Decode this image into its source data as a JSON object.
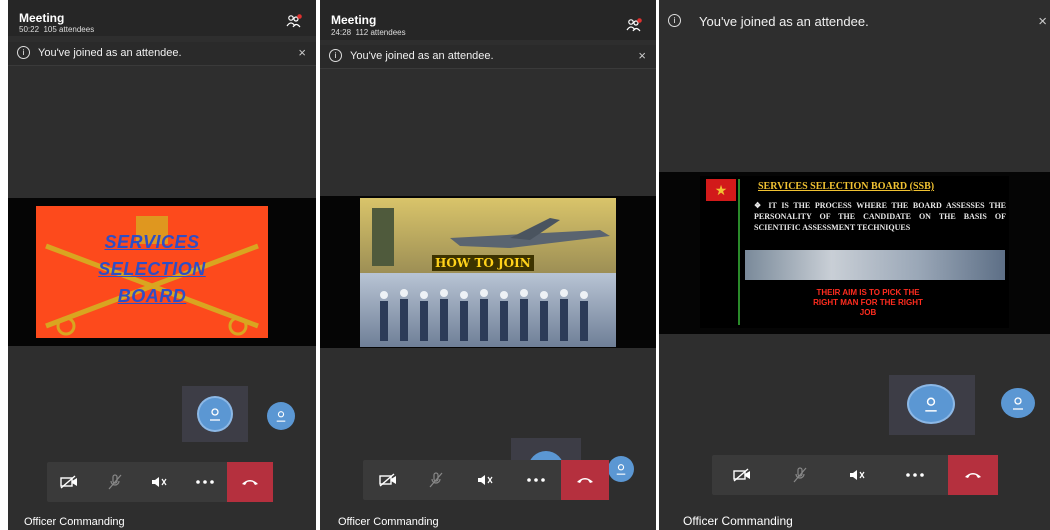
{
  "screens": [
    {
      "title": "Meeting",
      "time": "50:22",
      "attendees": "105 attendees",
      "notice": "You've joined as an attendee.",
      "close": "×",
      "slide_lines": [
        "SERVICES",
        "SELECTION",
        "BOARD"
      ],
      "footer": "Officer Commanding"
    },
    {
      "title": "Meeting",
      "time": "24:28",
      "attendees": "112 attendees",
      "notice": "You've joined as an attendee.",
      "close": "×",
      "slide_label": "HOW TO JOIN",
      "footer": "Officer Commanding"
    },
    {
      "notice": "You've joined as an attendee.",
      "close": "×",
      "slide_title": "SERVICES SELECTION BOARD (SSB)",
      "slide_body": "❖ IT IS THE PROCESS WHERE THE BOARD ASSESSES THE PERSONALITY OF THE CANDIDATE ON THE BASIS OF SCIENTIFIC ASSESSMENT TECHNIQUES",
      "slide_aim": "THEIR AIM IS TO PICK THE RIGHT MAN FOR THE RIGHT JOB",
      "footer": "Officer Commanding"
    }
  ],
  "icons": {
    "people": "people-icon",
    "camera_off": "camera-off-icon",
    "mic_off": "mic-off-icon",
    "speaker": "speaker-icon",
    "more": "more-icon",
    "hangup": "hangup-icon",
    "avatar": "person-icon"
  },
  "colors": {
    "background": "#2e2e2e",
    "hangup": "#b5303e",
    "avatar": "#5b97d3",
    "notification_dot": "#e0312f"
  }
}
